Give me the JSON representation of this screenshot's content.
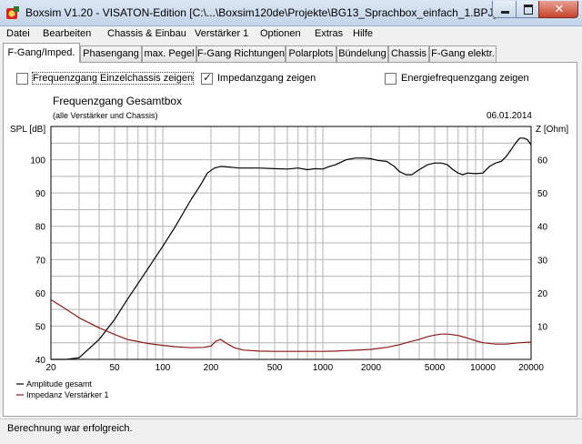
{
  "window": {
    "title": "Boxsim V1.20 - VISATON-Edition [C:\\...\\Boxsim120de\\Projekte\\BG13_Sprachbox_einfach_1.BPJ]",
    "close_glyph": "✕"
  },
  "menu": [
    "Datei",
    "Bearbeiten",
    "Chassis & Einbau",
    "Verstärker 1",
    "Optionen",
    "Extras",
    "Hilfe"
  ],
  "tabs": [
    "F-Gang/Imped.",
    "Phasengang",
    "max. Pegel",
    "F-Gang Richtungen",
    "Polarplots",
    "Bündelung",
    "Chassis",
    "F-Gang elektr."
  ],
  "active_tab": 0,
  "options": [
    {
      "label": "Frequenzgang Einzelchassis zeigen",
      "checked": false
    },
    {
      "label": "Impedanzgang zeigen",
      "checked": true
    },
    {
      "label": "Energiefrequenzgang zeigen",
      "checked": false
    }
  ],
  "status": "Berechnung war erfolgreich.",
  "colors": {
    "amplitude": "#000000",
    "impedance": "#8b1a1a",
    "grid": "#b4b4b4"
  },
  "chart_data": {
    "type": "line",
    "title": "Frequenzgang Gesamtbox",
    "subtitle": "(alle Verstärker und Chassis)",
    "date": "06.01.2014",
    "ylabel_left": "SPL [dB]",
    "ylabel_right": "Z [Ohm]",
    "x_scale": "log",
    "xlim": [
      20,
      20000
    ],
    "ylim_left": [
      40,
      110
    ],
    "ylim_right": [
      0,
      70
    ],
    "x_ticks": [
      20,
      50,
      100,
      200,
      500,
      1000,
      2000,
      5000,
      10000,
      20000
    ],
    "y_ticks_left": [
      40,
      50,
      60,
      70,
      80,
      90,
      100
    ],
    "y_ticks_right": [
      10,
      20,
      30,
      40,
      50,
      60
    ],
    "grid": true,
    "legend_position": "bottom-left",
    "series": [
      {
        "name": "Amplitude gesamt",
        "axis": "left",
        "x": [
          20,
          25,
          30,
          40,
          50,
          60,
          80,
          100,
          120,
          150,
          170,
          190,
          210,
          230,
          260,
          300,
          400,
          500,
          600,
          700,
          800,
          900,
          1000,
          1100,
          1200,
          1400,
          1600,
          1800,
          2000,
          2200,
          2500,
          2800,
          3000,
          3300,
          3600,
          4000,
          4500,
          5000,
          5500,
          6000,
          6500,
          7000,
          7500,
          8000,
          9000,
          10000,
          11000,
          12000,
          13000,
          14000,
          15000,
          16000,
          17000,
          18000,
          19000,
          20000
        ],
        "y": [
          40,
          40,
          40.5,
          46,
          52,
          58,
          67,
          74,
          80,
          88,
          92,
          96,
          97.5,
          98,
          97.8,
          97.5,
          97.5,
          97.3,
          97.2,
          97.5,
          97,
          97.3,
          97.2,
          98,
          98.5,
          100,
          100.5,
          100.5,
          100.3,
          99.8,
          99.5,
          98,
          96.5,
          95.5,
          95.5,
          97,
          98.5,
          99,
          99,
          98.5,
          97,
          96,
          95.5,
          96,
          95.8,
          96,
          98,
          99,
          99.5,
          101,
          103,
          105,
          106.5,
          106.5,
          106,
          104.5
        ]
      },
      {
        "name": "Impedanz Verstärker 1",
        "axis": "right",
        "x": [
          20,
          25,
          30,
          40,
          50,
          60,
          80,
          100,
          120,
          150,
          180,
          200,
          215,
          230,
          250,
          280,
          320,
          400,
          500,
          600,
          800,
          1000,
          1200,
          1500,
          2000,
          2500,
          3000,
          3500,
          4000,
          4500,
          5000,
          5500,
          6000,
          7000,
          8000,
          9000,
          10000,
          12000,
          14000,
          17000,
          20000
        ],
        "y": [
          18,
          15,
          12.5,
          9.5,
          7.5,
          6,
          4.8,
          4.2,
          3.8,
          3.5,
          3.6,
          4,
          5.5,
          6,
          4.8,
          3.5,
          2.8,
          2.5,
          2.4,
          2.4,
          2.4,
          2.4,
          2.5,
          2.7,
          3,
          3.6,
          4.4,
          5.3,
          6,
          6.8,
          7.3,
          7.6,
          7.6,
          7.2,
          6.4,
          5.6,
          5,
          4.6,
          4.6,
          5,
          5.2
        ]
      }
    ]
  }
}
